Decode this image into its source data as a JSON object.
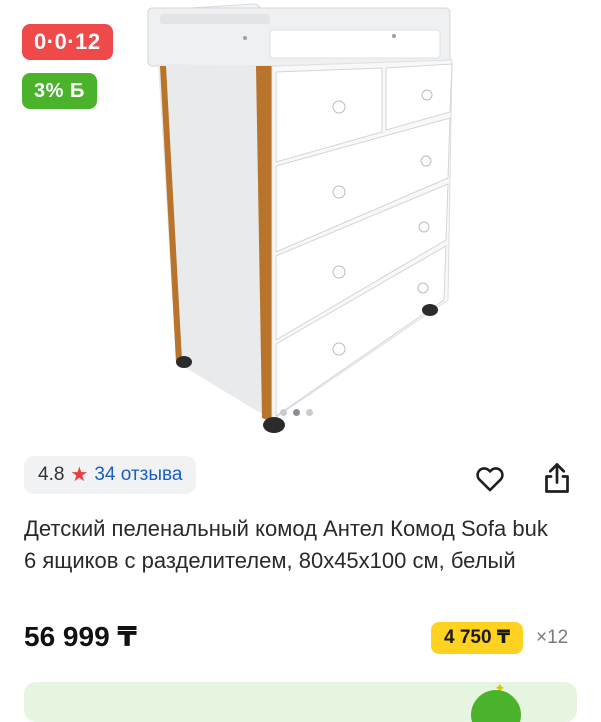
{
  "gallery": {
    "badges": {
      "installment": "0·0·12",
      "bonus": "3% Б"
    },
    "image_icon": "product-photo-dresser",
    "pagination": {
      "total": 3,
      "active": 1
    }
  },
  "rating": {
    "value": "4.8",
    "reviews_label": "34 отзыва",
    "star_color": "#ee3c3c"
  },
  "actions": {
    "favorite_icon": "heart-icon",
    "share_icon": "share-icon"
  },
  "product": {
    "title": "Детский пеленальный комод Антел Комод Sofa buk 6 ящиков с разделителем, 80х45х100 см, белый",
    "price": "56 999 ₸",
    "installment_amount": "4 750 ₸",
    "installment_months": "×12"
  },
  "colors": {
    "installment_badge": "#f0494a",
    "bonus_badge": "#4bb32b",
    "installment_pill": "#ffd21f",
    "link": "#1a5fc2"
  }
}
